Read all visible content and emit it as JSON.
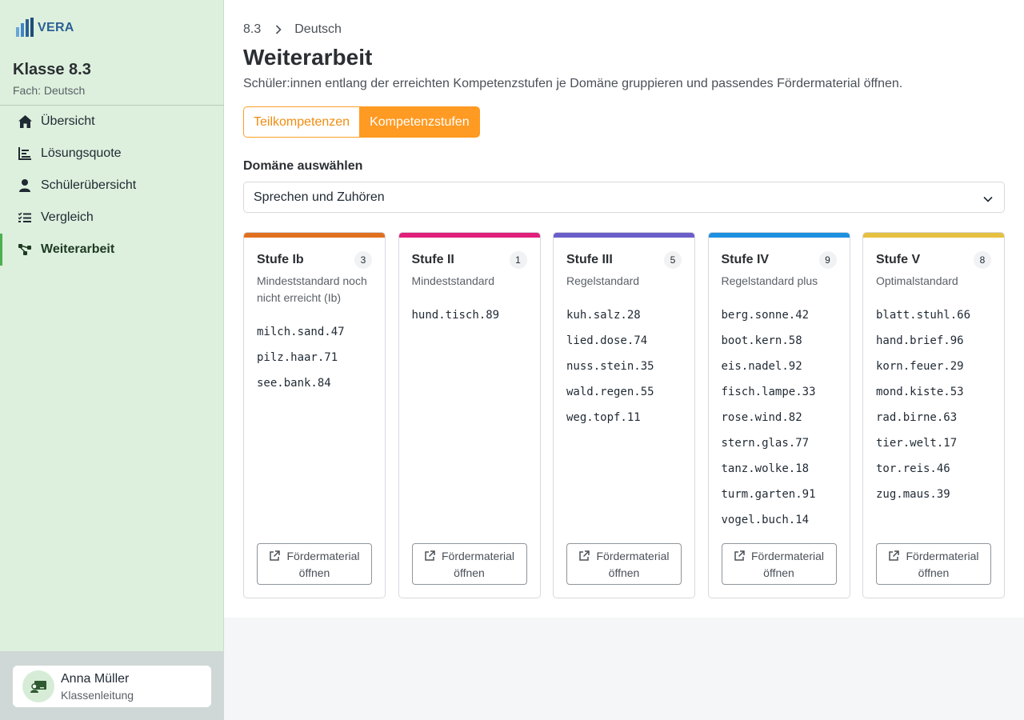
{
  "brand": {
    "name": "VERA"
  },
  "sidebar": {
    "class_title": "Klasse 8.3",
    "subject": "Fach: Deutsch",
    "items": [
      {
        "label": "Übersicht",
        "icon": "home-icon"
      },
      {
        "label": "Lösungsquote",
        "icon": "bar-chart-icon"
      },
      {
        "label": "Schülerübersicht",
        "icon": "person-icon"
      },
      {
        "label": "Vergleich",
        "icon": "checklist-icon"
      },
      {
        "label": "Weiterarbeit",
        "icon": "hierarchy-icon",
        "active": true
      }
    ],
    "user": {
      "name": "Anna Müller",
      "role": "Klassenleitung",
      "icon": "teacher-icon"
    }
  },
  "breadcrumb": {
    "class": "8.3",
    "subject": "Deutsch"
  },
  "page": {
    "title": "Weiterarbeit",
    "description": "Schüler:innen entlang der erreichten Kompetenzstufen je Domäne gruppieren und passendes Fördermaterial öffnen."
  },
  "toggle": {
    "option_a": "Teilkompetenzen",
    "option_b": "Kompetenzstufen",
    "selected": "Kompetenzstufen"
  },
  "domain": {
    "label": "Domäne auswählen",
    "selected": "Sprechen und Zuhören"
  },
  "colors": {
    "accent": "#ff9a22",
    "active_nav": "#4caf50",
    "brand": "#2b5f94"
  },
  "levels": [
    {
      "title": "Stufe Ib",
      "count": "3",
      "subtitle": "Mindeststandard noch nicht erreicht (Ib)",
      "color": "#e07020",
      "students": [
        "milch.sand.47",
        "pilz.haar.71",
        "see.bank.84"
      ]
    },
    {
      "title": "Stufe II",
      "count": "1",
      "subtitle": "Mindeststandard",
      "color": "#e0207a",
      "students": [
        "hund.tisch.89"
      ]
    },
    {
      "title": "Stufe III",
      "count": "5",
      "subtitle": "Regelstandard",
      "color": "#6a5fc9",
      "students": [
        "kuh.salz.28",
        "lied.dose.74",
        "nuss.stein.35",
        "wald.regen.55",
        "weg.topf.11"
      ]
    },
    {
      "title": "Stufe IV",
      "count": "9",
      "subtitle": "Regelstandard plus",
      "color": "#1e90e0",
      "students": [
        "berg.sonne.42",
        "boot.kern.58",
        "eis.nadel.92",
        "fisch.lampe.33",
        "rose.wind.82",
        "stern.glas.77",
        "tanz.wolke.18",
        "turm.garten.91",
        "vogel.buch.14"
      ]
    },
    {
      "title": "Stufe V",
      "count": "8",
      "subtitle": "Optimalstandard",
      "color": "#e6c040",
      "students": [
        "blatt.stuhl.66",
        "hand.brief.96",
        "korn.feuer.29",
        "mond.kiste.53",
        "rad.birne.63",
        "tier.welt.17",
        "tor.reis.46",
        "zug.maus.39"
      ]
    }
  ],
  "material_button": {
    "line1": "Fördermaterial",
    "line2": "öffnen"
  }
}
